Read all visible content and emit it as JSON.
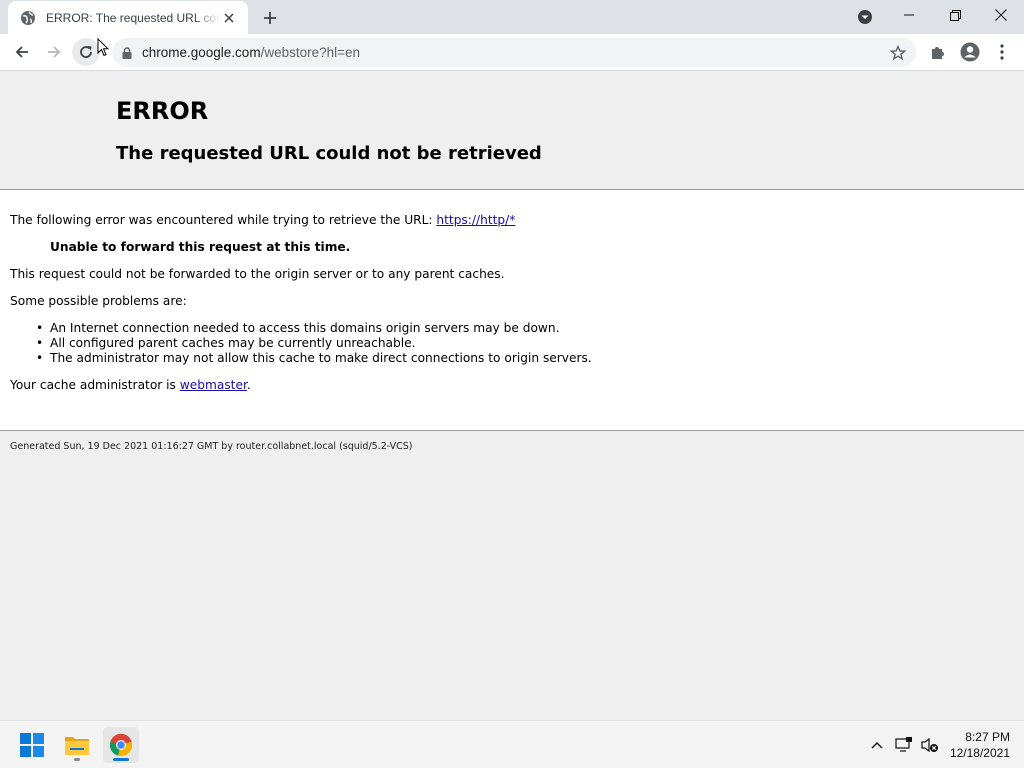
{
  "browser": {
    "tab": {
      "title": "ERROR: The requested URL could not be retrieved"
    },
    "url": {
      "host": "chrome.google.com",
      "path": "/webstore?hl=en"
    }
  },
  "page": {
    "h1": "ERROR",
    "h2": "The requested URL could not be retrieved",
    "intro": "The following error was encountered while trying to retrieve the URL:",
    "intro_link": "https://http/*",
    "error_detail": "Unable to forward this request at this time.",
    "explain": "This request could not be forwarded to the origin server or to any parent caches.",
    "problems_heading": "Some possible problems are:",
    "problems": [
      "An Internet connection needed to access this domains origin servers may be down.",
      "All configured parent caches may be currently unreachable.",
      "The administrator may not allow this cache to make direct connections to origin servers."
    ],
    "admin_prefix": "Your cache administrator is ",
    "admin_link": "webmaster",
    "admin_suffix": ".",
    "footer": "Generated Sun, 19 Dec 2021 01:16:27 GMT by router.collabnet.local (squid/5.2-VCS)"
  },
  "taskbar": {
    "time": "8:27 PM",
    "date": "12/18/2021"
  },
  "colors": {
    "link": "#1a0dab",
    "tabbar": "#dee1e6",
    "page_bg": "#efefef"
  }
}
